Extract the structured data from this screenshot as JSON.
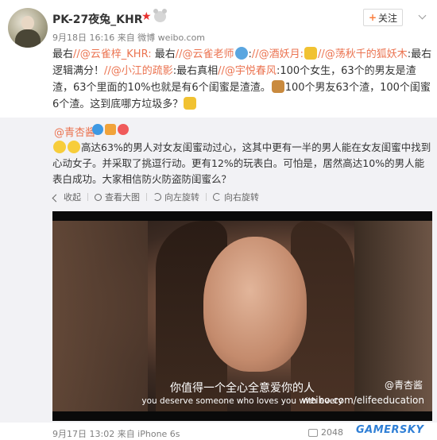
{
  "post": {
    "author": "PK-27夜兔_KHR",
    "vip_badge": "★",
    "meta": "9月18日 16:16 来自 微博 weibo.com",
    "follow_label": "关注",
    "follow_plus": "+",
    "text": {
      "seg1": "最右",
      "at1": "//@云雀梓_KHR:",
      "seg2": " 最右",
      "at2": "//@云雀老师",
      "seg3": ":",
      "at3": "//@酒妖月:",
      "at4": "//@荡秋千的狐妖木",
      "seg4": ":最右逻辑满分！",
      "at5": "//@小江的疏影",
      "seg5": ":最右真相",
      "at6": "//@宇悦春风",
      "seg6": ":100个女生，63个的男友是渣渣，63个里面的10%也就是有6个闺蜜是渣渣。",
      "seg7": "100个男友63个渣，100个闺蜜6个渣。这到底哪方垃圾多？"
    }
  },
  "repost": {
    "author": "@青杏酱",
    "text": "高达63%的男人对女友闺蜜动过心，这其中更有一半的男人能在女友闺蜜中找到心动女子。并采取了挑逗行动。更有12%的玩表白。可怕是，居然高达10%的男人能表白成功。大家相信防火防盗防闺蜜么？",
    "tools": {
      "collapse": "收起",
      "view_large": "查看大图",
      "rotate_left": "向左旋转",
      "rotate_right": "向右旋转"
    },
    "video": {
      "subtitle_cn": "你值得一个全心全意爱你的人",
      "subtitle_en": "you deserve someone who loves you with every",
      "watermark_user": "@青杏酱",
      "watermark_url": "weibo.com/elifeeducation"
    },
    "meta": "9月17日 13:02 来自 iPhone 6s",
    "share_count": "2048"
  },
  "site_watermark": "GAMERSKY",
  "colors": {
    "link": "#eb7350",
    "repost_bg": "#f2f2f5",
    "brand_watermark": "#2f7fd6"
  }
}
